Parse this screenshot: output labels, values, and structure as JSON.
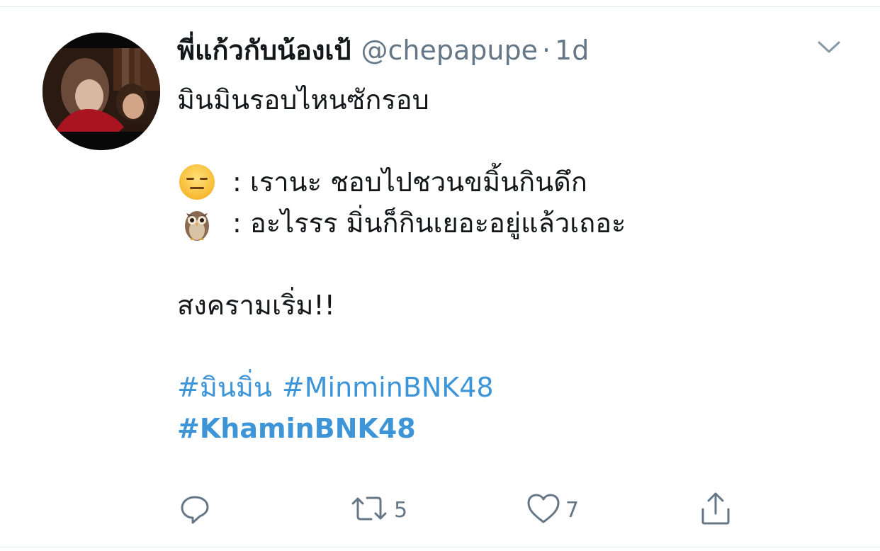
{
  "tweet": {
    "display_name": "พี่แก้วกับน้องเป้",
    "handle": "@chepapupe",
    "separator": "·",
    "time": "1d",
    "lines": {
      "l1": "มินมินรอบไหนซักรอบ",
      "l2": ": เรานะ ชอบไปชวนขมิ้นกินดึก",
      "l3": ": อะไรรร มิ่นก็กินเยอะอยู่แล้วเถอะ",
      "l4": "สงครามเริ่ม!!"
    },
    "emoji": {
      "l2": "expressionless-face-emoji",
      "l3": "owl-emoji"
    },
    "hashtags": {
      "h1": "#มินมิ่น",
      "h2": "#MinminBNK48",
      "h3": "#KhaminBNK48"
    }
  },
  "actions": {
    "reply_icon": "reply-icon",
    "retweet_icon": "retweet-icon",
    "retweet_count": "5",
    "like_icon": "heart-icon",
    "like_count": "7",
    "share_icon": "share-icon"
  },
  "colors": {
    "link": "#3d95d8",
    "secondary": "#657786",
    "text": "#14171a",
    "divider": "#e6ecf0"
  }
}
